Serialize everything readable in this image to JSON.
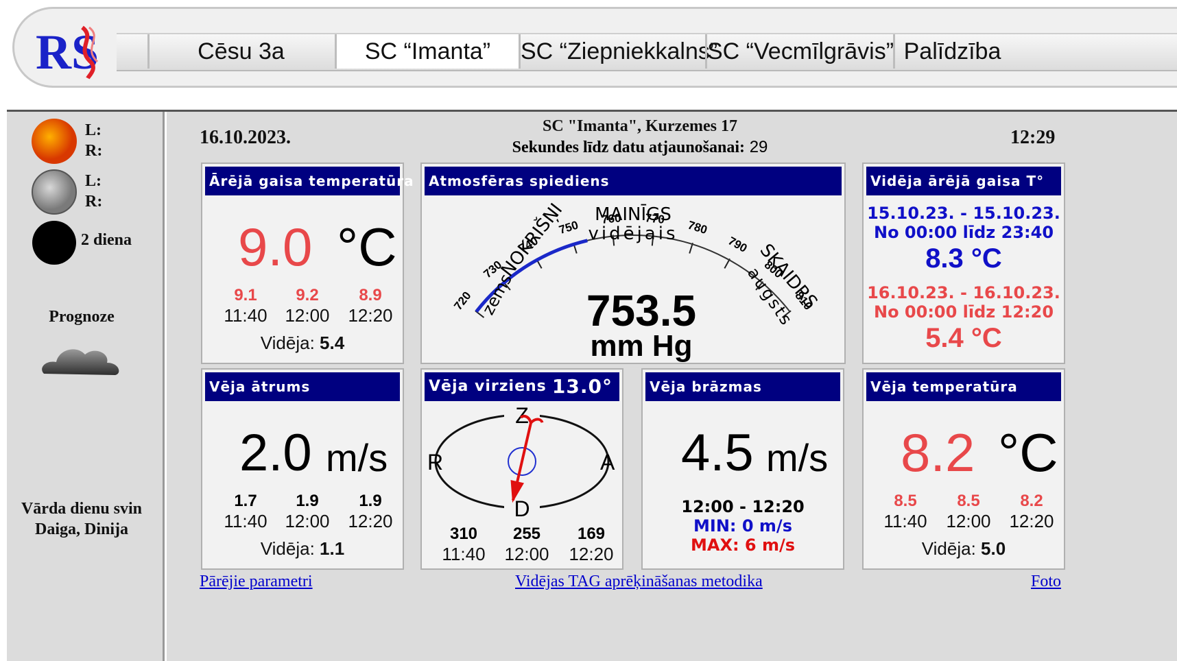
{
  "colors": {
    "nav_blue": "#000080",
    "temp_red": "#e8484a",
    "stat_blue": "#1010c8",
    "max_red": "#e01010",
    "link_blue": "#0000cc"
  },
  "header": {
    "logo_text": "RS",
    "tabs": [
      "Cēsu 3a",
      "SC “Imanta”",
      "SC “Ziepniekkalns”",
      "SC “Vecmīlgrāvis”",
      "Palīdzība"
    ]
  },
  "sidebar": {
    "sun": {
      "l": "L:",
      "r": "R:"
    },
    "moon": {
      "l": "L:",
      "r": "R:"
    },
    "moon_phase": "2 diena",
    "forecast_label": "Prognoze",
    "name_day_title": "Vārda dienu svin",
    "name_day_names": "Daiga, Dinija"
  },
  "main": {
    "date": "16.10.2023.",
    "station": "SC \"Imanta\", Kurzemes 17",
    "refresh_label": "Sekundes līdz datu atjaunošanai:",
    "refresh_seconds": "29",
    "time": "12:29"
  },
  "panels": {
    "air_temp": {
      "title": "Ārējā gaisa temperatūra",
      "value": "9.0",
      "unit": "°C",
      "history": [
        {
          "v": "9.1",
          "t": "11:40"
        },
        {
          "v": "9.2",
          "t": "12:00"
        },
        {
          "v": "8.9",
          "t": "12:20"
        }
      ],
      "avg_label": "Vidēja:",
      "avg_value": "5.4"
    },
    "pressure": {
      "title": "Atmosfēras spiediens",
      "value": "753.5",
      "unit": "mm Hg",
      "min": 720,
      "max": 810,
      "current": 753.5,
      "ticks": [
        "720",
        "730",
        "740",
        "750",
        "760",
        "770",
        "780",
        "790",
        "800",
        "810"
      ],
      "label_left": "NOKRIŠŅI",
      "label_left2": "zems",
      "label_top": "MAINĪGS",
      "label_top2": "vidējais",
      "label_right": "SKAIDRS",
      "label_right2": "augsts"
    },
    "avg_temp": {
      "title": "Vidēja ārējā gaisa T°",
      "period1": "15.10.23. - 15.10.23.",
      "range1": "No 00:00 līdz 23:40",
      "value1": "8.3 °C",
      "period2": "16.10.23. - 16.10.23.",
      "range2": "No 00:00 līdz 12:20",
      "value2": "5.4 °C"
    },
    "wind_speed": {
      "title": "Vēja ātrums",
      "value": "2.0",
      "unit": "m/s",
      "history": [
        {
          "v": "1.7",
          "t": "11:40"
        },
        {
          "v": "1.9",
          "t": "12:00"
        },
        {
          "v": "1.9",
          "t": "12:20"
        }
      ],
      "avg_label": "Vidēja:",
      "avg_value": "1.1"
    },
    "wind_dir": {
      "title": "Vēja virziens",
      "degrees": "13.0°",
      "angle": 13.0,
      "compass": {
        "n": "Z",
        "s": "D",
        "w": "R",
        "e": "A"
      },
      "history": [
        {
          "v": "310",
          "t": "11:40"
        },
        {
          "v": "255",
          "t": "12:00"
        },
        {
          "v": "169",
          "t": "12:20"
        }
      ]
    },
    "gusts": {
      "title": "Vēja brāzmas",
      "value": "4.5",
      "unit": "m/s",
      "period": "12:00 - 12:20",
      "min": "MIN: 0 m/s",
      "max": "MAX: 6 m/s"
    },
    "wind_temp": {
      "title": "Vēja temperatūra",
      "value": "8.2",
      "unit": "°C",
      "history": [
        {
          "v": "8.5",
          "t": "11:40"
        },
        {
          "v": "8.5",
          "t": "12:00"
        },
        {
          "v": "8.2",
          "t": "12:20"
        }
      ],
      "avg_label": "Vidēja:",
      "avg_value": "5.0"
    }
  },
  "links": {
    "other_params": "Pārējie parametri",
    "method": "Vidējas TAG aprēķināšanas metodika",
    "photo": "Foto"
  }
}
